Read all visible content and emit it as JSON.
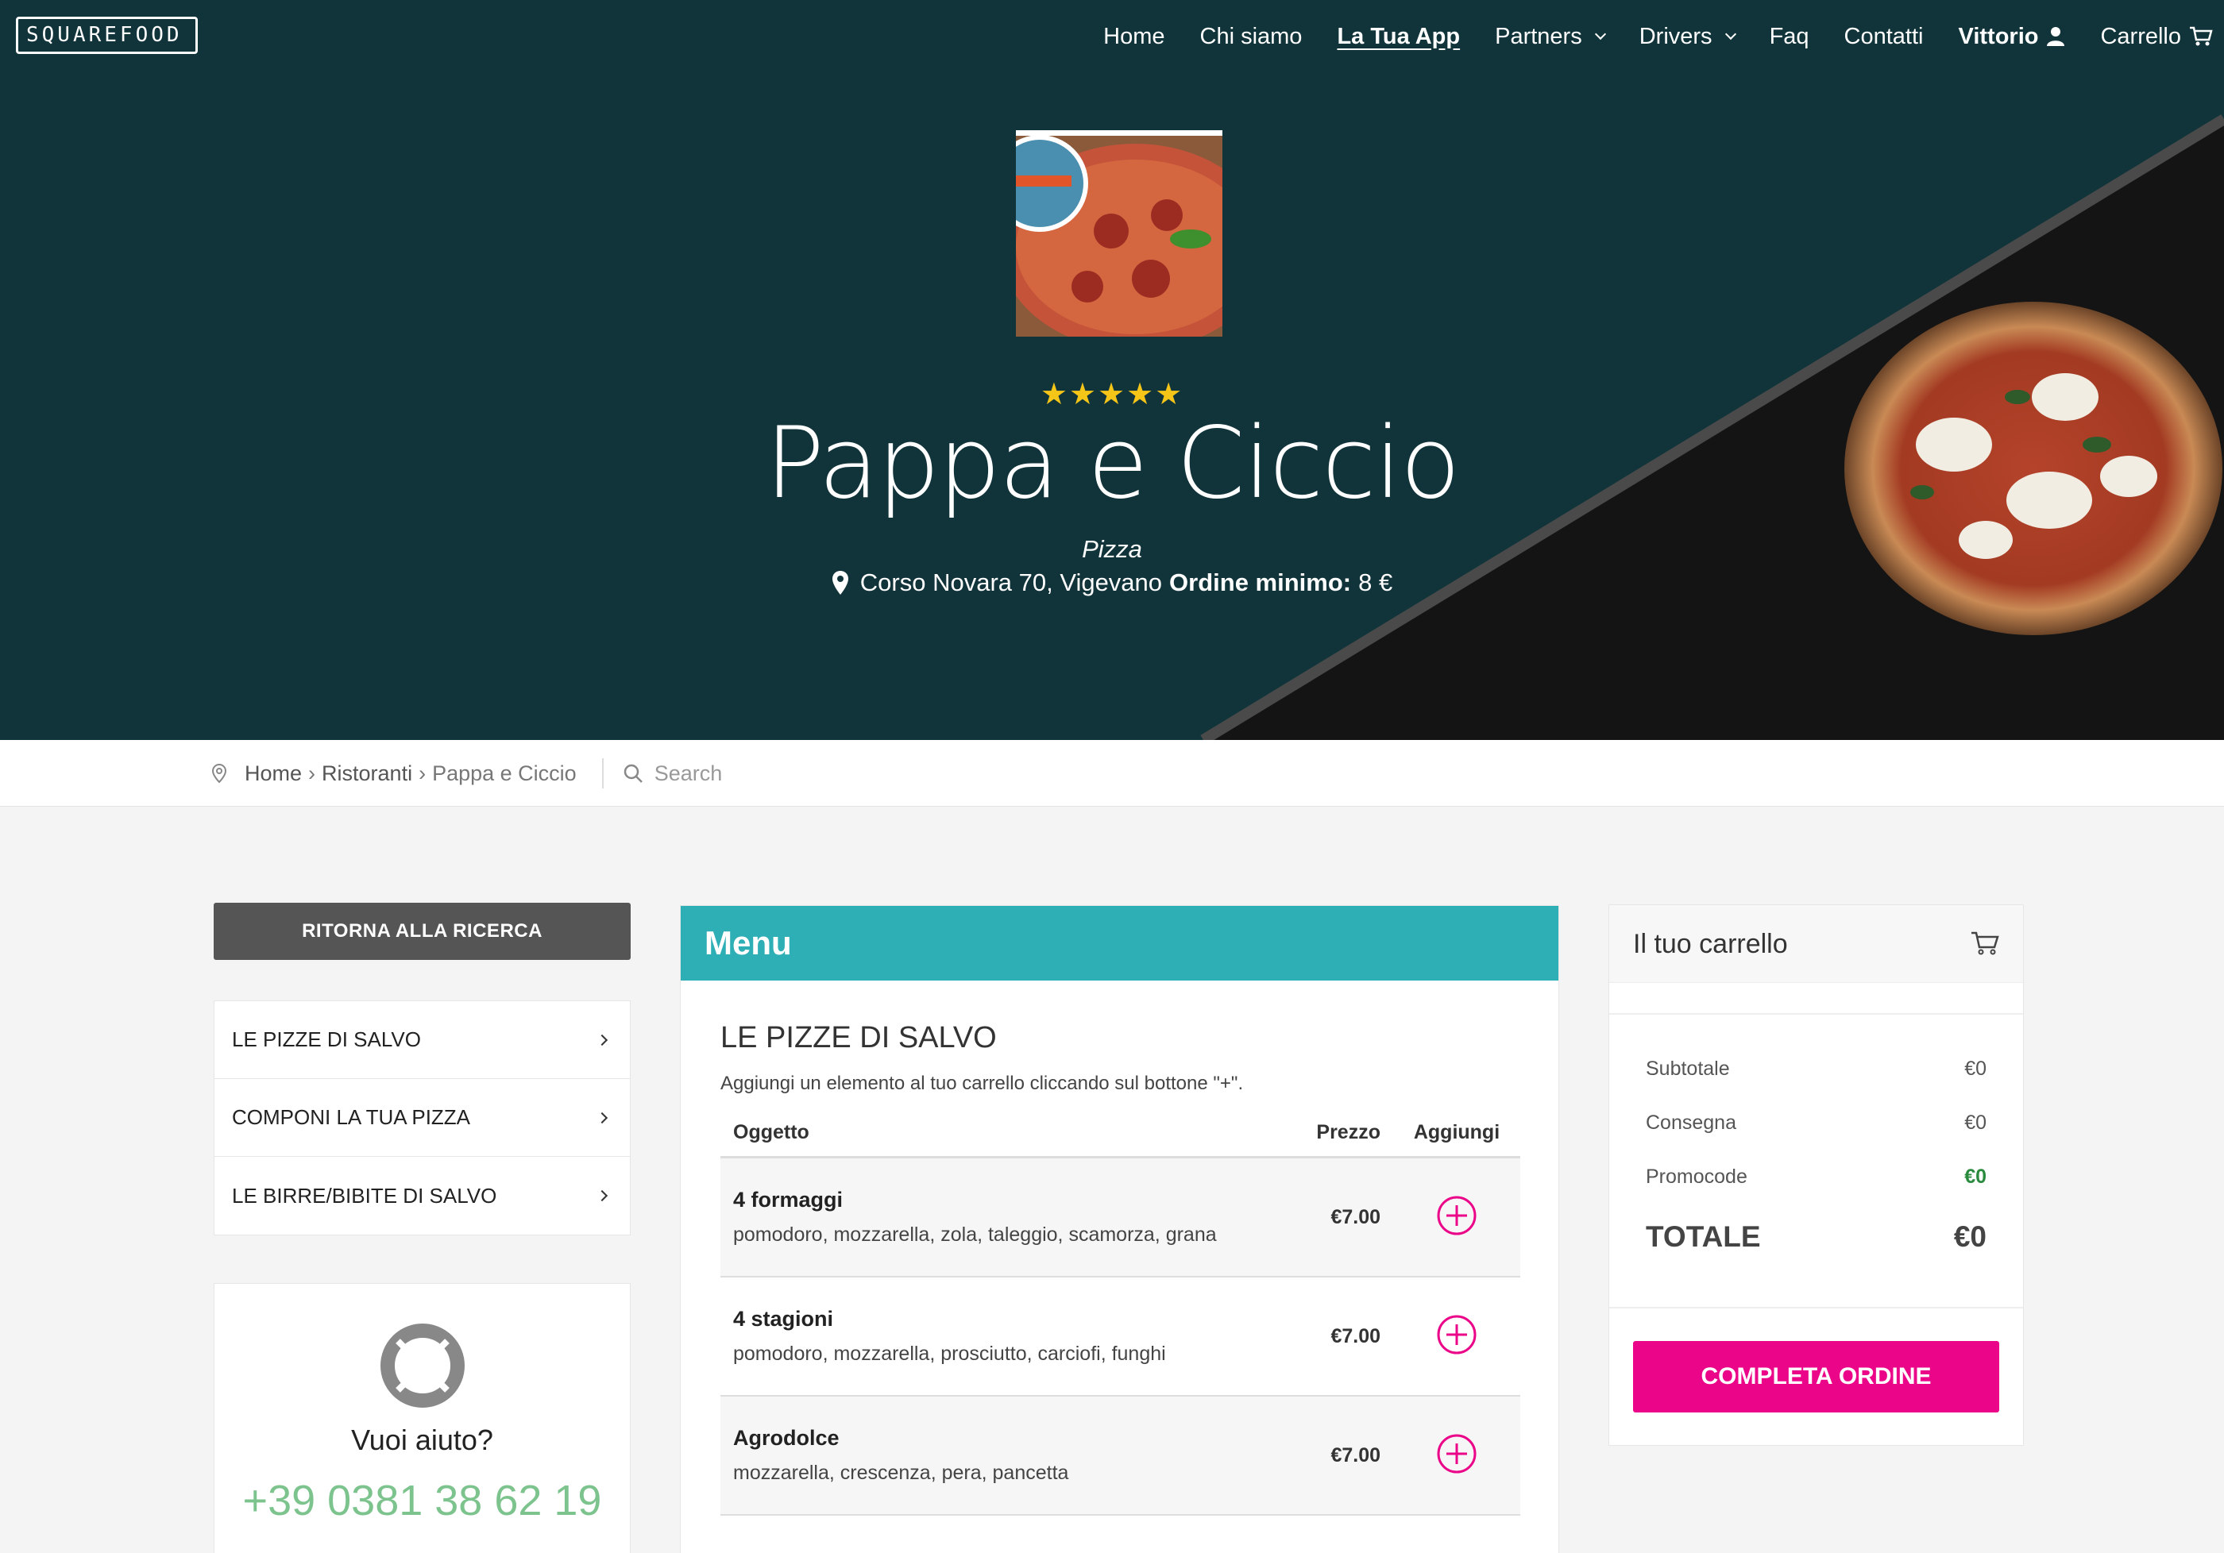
{
  "brand": {
    "logo_text": "SQUAREFOOD"
  },
  "nav": {
    "items": [
      {
        "label": "Home"
      },
      {
        "label": "Chi siamo"
      },
      {
        "label": "La Tua App"
      },
      {
        "label": "Partners"
      },
      {
        "label": "Drivers"
      },
      {
        "label": "Faq"
      },
      {
        "label": "Contatti"
      },
      {
        "label": "Vittorio"
      },
      {
        "label": "Carrello"
      }
    ]
  },
  "restaurant": {
    "rating": 5,
    "stars": "★★★★★",
    "name": "Pappa e Ciccio",
    "cuisine": "Pizza",
    "address": "Corso Novara 70, Vigevano",
    "min_order_label": "Ordine minimo:",
    "min_order_value": "8 €"
  },
  "breadcrumb": {
    "items": [
      "Home",
      "Ristoranti",
      "Pappa e Ciccio"
    ],
    "separator": "›",
    "search_placeholder": "Search"
  },
  "sidebar": {
    "back_button": "RITORNA ALLA RICERCA",
    "categories": [
      "LE PIZZE DI SALVO",
      "COMPONI LA TUA PIZZA",
      "LE BIRRE/BIBITE DI SALVO"
    ],
    "help_title": "Vuoi aiuto?",
    "help_phone": "+39 0381 38 62 19"
  },
  "menu": {
    "header": "Menu",
    "section_title": "LE PIZZE DI SALVO",
    "section_hint": "Aggiungi un elemento al tuo carrello cliccando sul bottone \"+\".",
    "columns": {
      "item": "Oggetto",
      "price": "Prezzo",
      "add": "Aggiungi"
    },
    "items": [
      {
        "name": "4 formaggi",
        "desc": "pomodoro, mozzarella, zola, taleggio, scamorza, grana",
        "price": "€7.00"
      },
      {
        "name": "4 stagioni",
        "desc": "pomodoro, mozzarella, prosciutto, carciofi, funghi",
        "price": "€7.00"
      },
      {
        "name": "Agrodolce",
        "desc": "mozzarella, crescenza, pera, pancetta",
        "price": "€7.00"
      }
    ]
  },
  "cart": {
    "title": "Il tuo carrello",
    "subtotal_label": "Subtotale",
    "subtotal_value": "€0",
    "delivery_label": "Consegna",
    "delivery_value": "€0",
    "promo_label": "Promocode",
    "promo_value": "€0",
    "total_label": "TOTALE",
    "total_value": "€0",
    "checkout_button": "COMPLETA ORDINE"
  },
  "colors": {
    "hero_bg": "#11343a",
    "menu_header": "#2eaeb5",
    "checkout": "#ea0589",
    "phone": "#7cc38d",
    "stars": "#f5c518",
    "promo_value": "#2a8a3e"
  },
  "icons": [
    "bike-icon",
    "user-icon",
    "cart-icon",
    "map-pin-icon",
    "location-icon",
    "search-icon",
    "chevron-right-icon",
    "lifebuoy-icon",
    "plus-circle-icon",
    "chevron-down-icon"
  ]
}
